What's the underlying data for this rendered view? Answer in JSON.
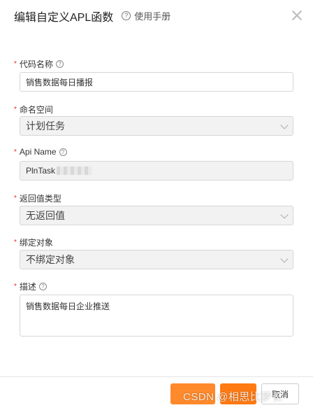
{
  "dialog": {
    "title": "编辑自定义APL函数",
    "help_label": "使用手册"
  },
  "fields": {
    "code_name": {
      "label": "代码名称",
      "value": "销售数据每日播报"
    },
    "namespace": {
      "label": "命名空间",
      "value": "计划任务"
    },
    "api_name": {
      "label": "Api Name",
      "value": "PlnTask"
    },
    "return_type": {
      "label": "返回值类型",
      "value": "无返回值"
    },
    "bind_object": {
      "label": "绑定对象",
      "value": "不绑定对象"
    },
    "description": {
      "label": "描述",
      "value": "销售数据每日企业推送"
    }
  },
  "footer": {
    "watermark": "CSDN @相思比梦长",
    "cancel_label": "取消"
  },
  "colors": {
    "required": "#f5222d",
    "primary": "#ff7a12"
  }
}
